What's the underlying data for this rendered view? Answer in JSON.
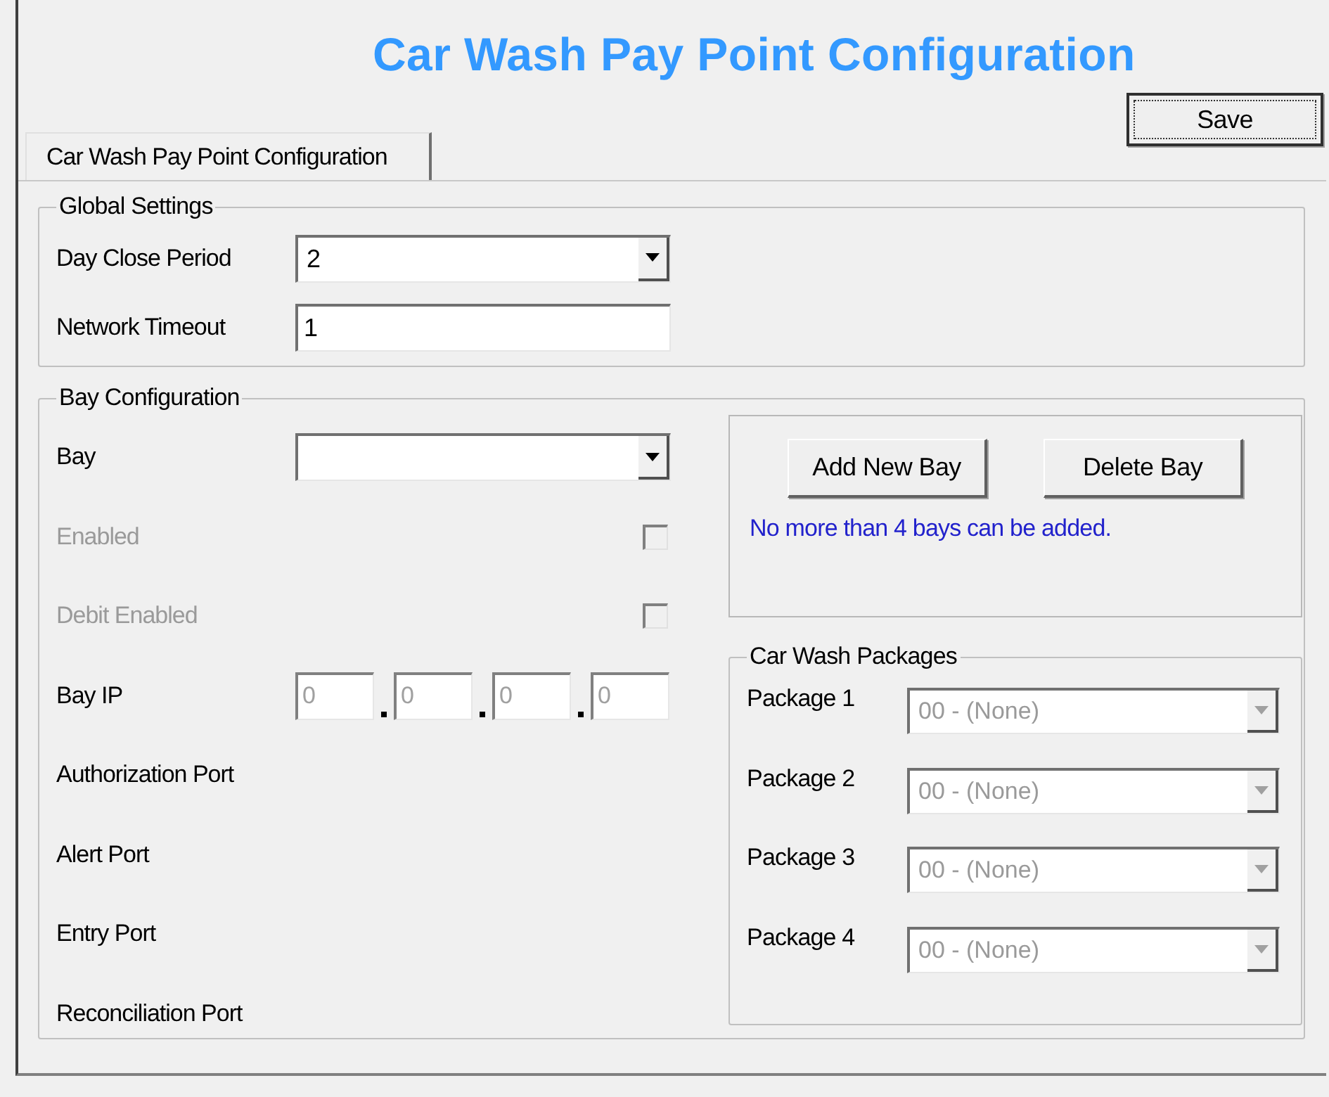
{
  "title": "Car Wash Pay Point Configuration",
  "save_button": "Save",
  "tabs": [
    {
      "label": "Car Wash Pay Point Configuration",
      "selected": true
    }
  ],
  "global_settings": {
    "title": "Global Settings",
    "fields": [
      {
        "label": "Day Close Period",
        "kind": "dropdown",
        "value": "2"
      },
      {
        "label": "Network Timeout",
        "kind": "text",
        "value": "1"
      }
    ]
  },
  "bay_configuration": {
    "title": "Bay Configuration",
    "fields": [
      {
        "label": "Bay",
        "kind": "dropdown"
      },
      {
        "label": "Enabled",
        "kind": "checkbox",
        "checked": false,
        "disabled": true
      },
      {
        "label": "Debit Enabled",
        "kind": "checkbox",
        "checked": false,
        "disabled": true
      },
      {
        "label": "Bay IP",
        "kind": "ip",
        "octets": [
          "0",
          "0",
          "0",
          "0"
        ],
        "disabled": true
      },
      {
        "label": "Authorization Port",
        "kind": "label"
      },
      {
        "label": "Alert Port",
        "kind": "label"
      },
      {
        "label": "Entry Port",
        "kind": "label"
      },
      {
        "label": "Reconciliation Port",
        "kind": "label"
      }
    ],
    "buttons": [
      "Add New Bay",
      "Delete Bay"
    ],
    "note": "No more than 4 bays can be added.",
    "packages": {
      "title": "Car Wash Packages",
      "items": [
        {
          "label": "Package 1",
          "value": "00 - (None)",
          "disabled": true
        },
        {
          "label": "Package 2",
          "value": "00 - (None)",
          "disabled": true
        },
        {
          "label": "Package 3",
          "value": "00 - (None)",
          "disabled": true
        },
        {
          "label": "Package 4",
          "value": "00 - (None)",
          "disabled": true
        }
      ]
    }
  }
}
